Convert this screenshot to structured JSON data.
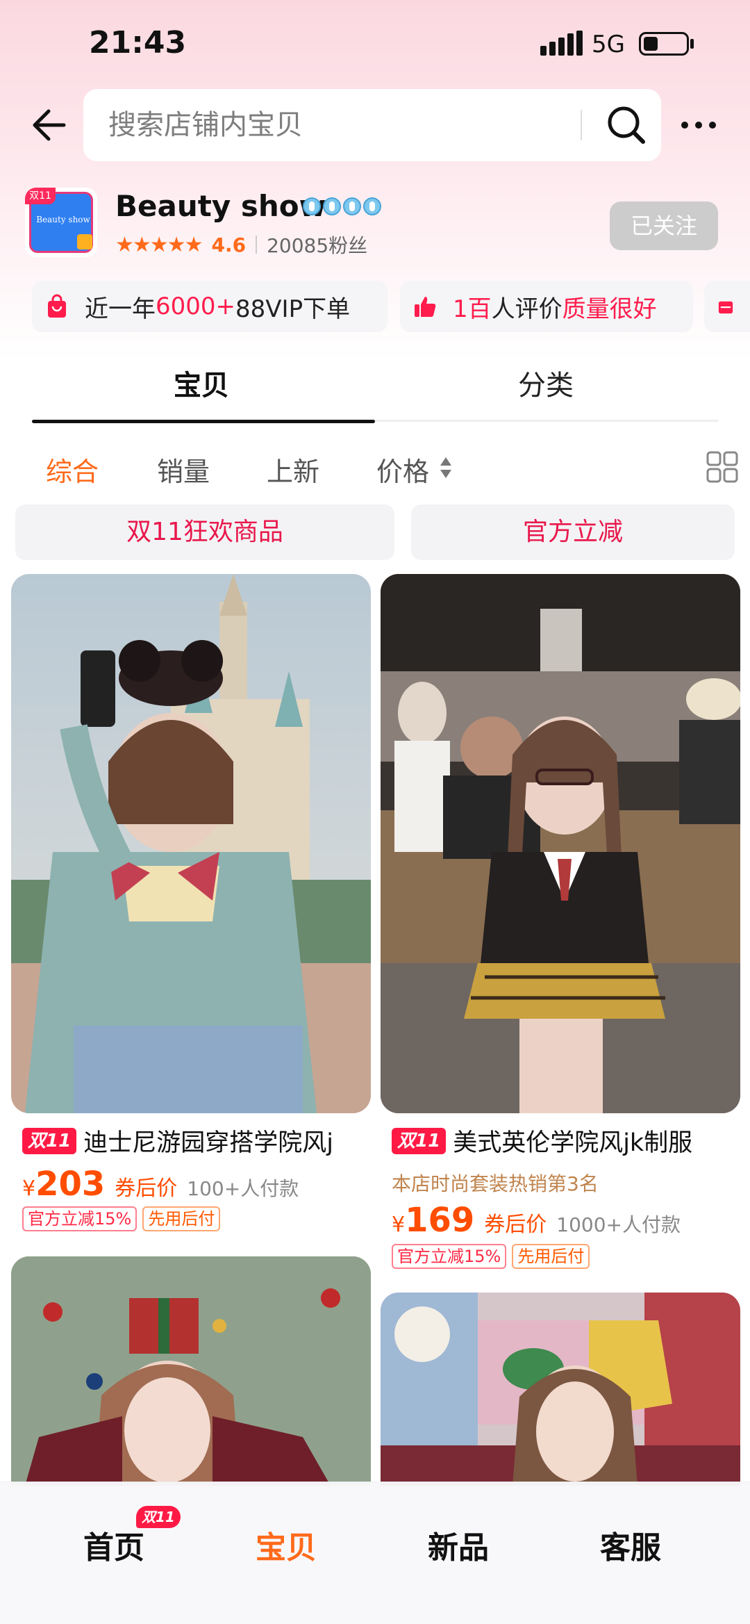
{
  "status_bar": {
    "time": "21:43",
    "network": "5G",
    "battery_level": 0.25
  },
  "header": {
    "search_placeholder": "搜索店铺内宝贝"
  },
  "shop": {
    "logo_text": "Beauty show",
    "logo_tag": "双11",
    "name": "Beauty show",
    "rating": "4.6",
    "stars": "★★★★★",
    "fans": "20085粉丝",
    "follow_label": "已关注"
  },
  "highlights": [
    {
      "prefix": "近一年",
      "highlight": "6000+",
      "suffix": "88VIP下单"
    },
    {
      "prefix": "",
      "highlight": "1百",
      "suffix": "人评价",
      "highlight2": "质量很好"
    }
  ],
  "tabs": [
    {
      "label": "宝贝",
      "active": true
    },
    {
      "label": "分类",
      "active": false
    }
  ],
  "sort": {
    "items": [
      "综合",
      "销量",
      "上新",
      "价格"
    ],
    "active": "综合"
  },
  "promos": [
    "双11狂欢商品",
    "官方立减"
  ],
  "products": [
    {
      "tag": "双11",
      "title": "迪士尼游园穿搭学院风j",
      "rank": "",
      "yen": "¥",
      "price": "203",
      "coupon_label": "券后价",
      "paid": "100+人付款",
      "tags": [
        "官方立减15%",
        "先用后付"
      ]
    },
    {
      "tag": "双11",
      "title": "美式英伦学院风jk制服",
      "rank": "本店时尚套装热销第3名",
      "yen": "¥",
      "price": "169",
      "coupon_label": "券后价",
      "paid": "1000+人付款",
      "tags": [
        "官方立减15%",
        "先用后付"
      ]
    }
  ],
  "bottom_nav": {
    "items": [
      {
        "label": "首页",
        "active": false
      },
      {
        "label": "宝贝",
        "active": true
      },
      {
        "label": "新品",
        "active": false
      },
      {
        "label": "客服",
        "active": false
      }
    ],
    "home_badge": "双11"
  },
  "colors": {
    "accent_orange": "#ff6a1a",
    "accent_red": "#ff1c4c",
    "price_orange": "#ff4d00"
  }
}
